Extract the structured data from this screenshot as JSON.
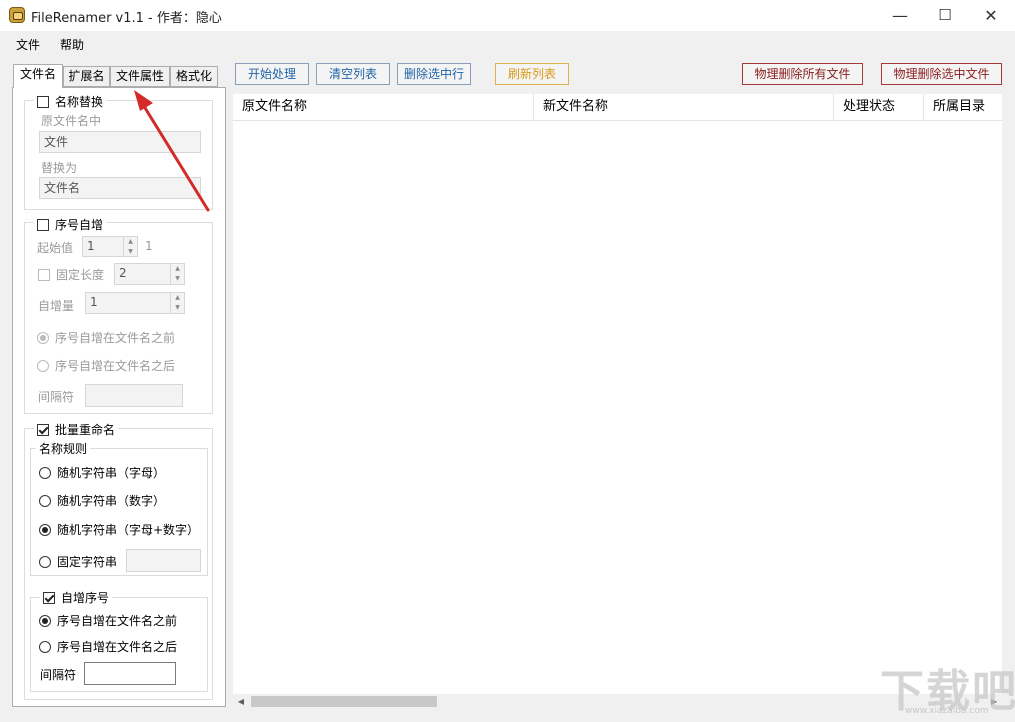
{
  "window": {
    "title": "FileRenamer v1.1 - 作者：隐心",
    "minimize_glyph": "—",
    "maximize_glyph": "☐",
    "close_glyph": "✕"
  },
  "menu": {
    "file": "文件",
    "help": "帮助"
  },
  "tabs": [
    {
      "label": "文件名",
      "active": true
    },
    {
      "label": "扩展名",
      "active": false
    },
    {
      "label": "文件属性",
      "active": false
    },
    {
      "label": "格式化",
      "active": false
    }
  ],
  "name_replace": {
    "title": "名称替换",
    "checked": false,
    "original_label": "原文件名中",
    "original_value": "文件",
    "replace_label": "替换为",
    "replace_value": "文件名"
  },
  "sequence": {
    "title": "序号自增",
    "checked": false,
    "start_label": "起始值",
    "start_value": "1",
    "start_hint": "1",
    "fixed_length_label": "固定长度",
    "fixed_length_value": "2",
    "increment_label": "自增量",
    "increment_value": "1",
    "before_label": "序号自增在文件名之前",
    "after_label": "序号自增在文件名之后",
    "separator_label": "间隔符"
  },
  "batch_rename": {
    "title": "批量重命名",
    "checked": true,
    "rule_title": "名称规则",
    "options": [
      {
        "label": "随机字符串（字母）",
        "selected": false
      },
      {
        "label": "随机字符串（数字）",
        "selected": false
      },
      {
        "label": "随机字符串（字母+数字）",
        "selected": true
      },
      {
        "label": "固定字符串",
        "selected": false
      }
    ],
    "auto_seq_title": "自增序号",
    "auto_seq_checked": true,
    "auto_before": "序号自增在文件名之前",
    "auto_after": "序号自增在文件名之后",
    "separator_label": "间隔符"
  },
  "toolbar": {
    "start": "开始处理",
    "clear": "清空列表",
    "delete_row": "删除选中行",
    "refresh": "刷新列表",
    "delete_all_physical": "物理删除所有文件",
    "delete_selected_physical": "物理删除选中文件"
  },
  "list": {
    "columns": [
      "原文件名称",
      "新文件名称",
      "处理状态",
      "所属目录"
    ]
  },
  "colors": {
    "annotation_arrow": "#d42a2a",
    "blue_button_text": "#1f63a8",
    "orange_button": "#d99a1a",
    "red_button": "#8b1c1c"
  }
}
